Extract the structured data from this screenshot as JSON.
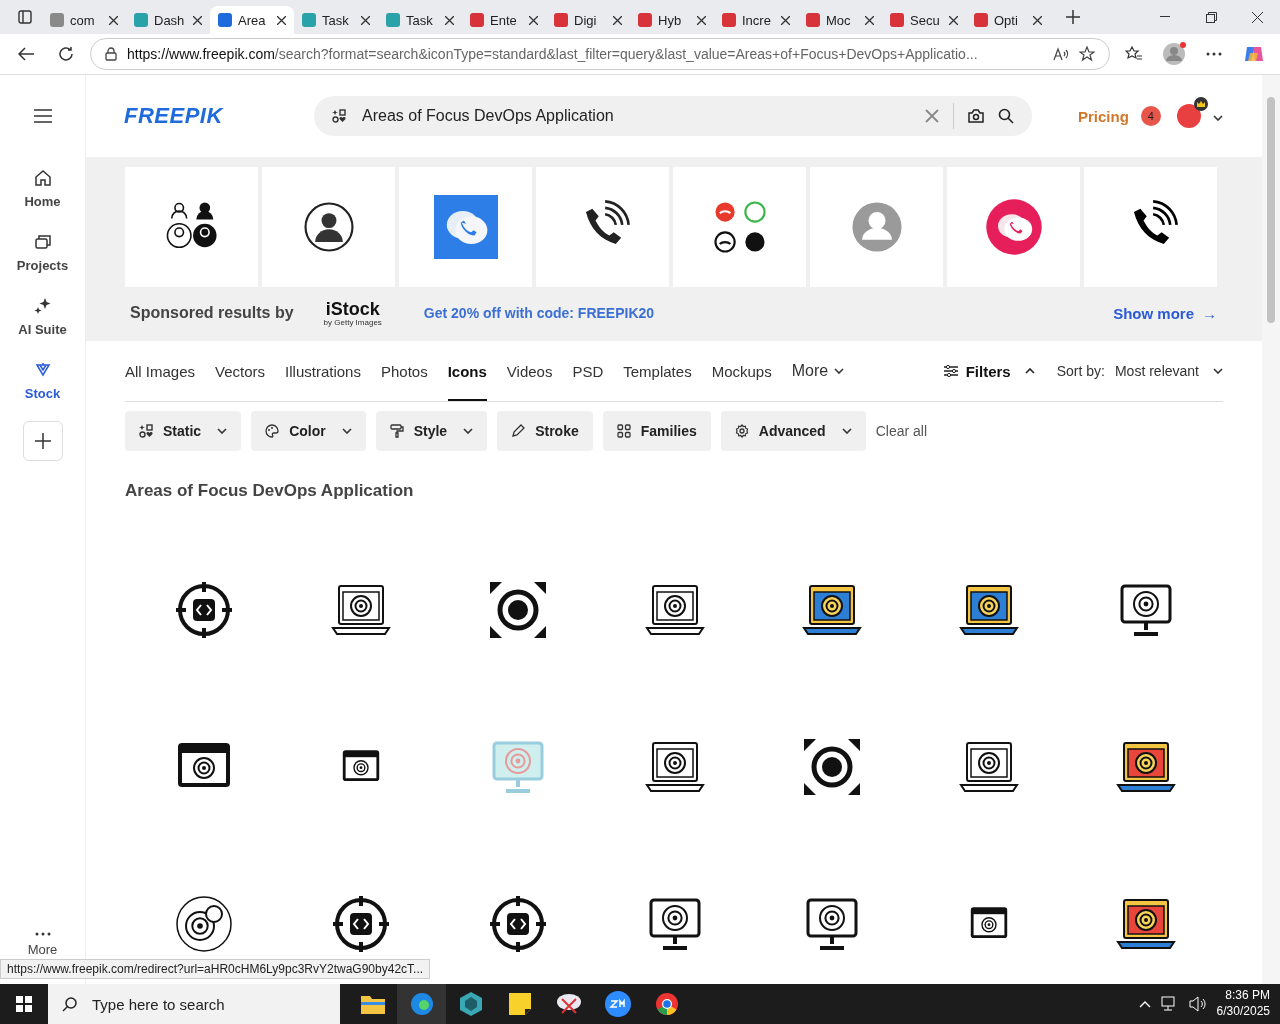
{
  "browser_tabs": [
    {
      "title": "com",
      "selected": false
    },
    {
      "title": "Dash",
      "selected": false
    },
    {
      "title": "Area",
      "selected": true
    },
    {
      "title": "Task",
      "selected": false
    },
    {
      "title": "Task",
      "selected": false
    },
    {
      "title": "Ente",
      "selected": false
    },
    {
      "title": "Digi",
      "selected": false
    },
    {
      "title": "Hyb",
      "selected": false
    },
    {
      "title": "Incre",
      "selected": false
    },
    {
      "title": "Moc",
      "selected": false
    },
    {
      "title": "Secu",
      "selected": false
    },
    {
      "title": "Opti",
      "selected": false
    }
  ],
  "address_bar": {
    "url_host": "https://www.freepik.com",
    "url_rest": "/search?format=search&iconType=standard&last_filter=query&last_value=Areas+of+Focus+DevOps+Applicatio..."
  },
  "sidebar": {
    "items": [
      {
        "label": "Home",
        "selected": false
      },
      {
        "label": "Projects",
        "selected": false
      },
      {
        "label": "AI Suite",
        "selected": false
      },
      {
        "label": "Stock",
        "selected": true
      }
    ],
    "more": "More"
  },
  "header": {
    "logo": "FREEPIK",
    "search_value": "Areas of Focus DevOps Application",
    "pricing": "Pricing",
    "notification_count": "4"
  },
  "sponsored": {
    "label": "Sponsored results by",
    "brand": "iStock",
    "brand_sub": "by Getty Images",
    "promo": "Get 20% off with code: FREEPIK20",
    "show_more": "Show more",
    "arrow": "→"
  },
  "categories": [
    {
      "label": "All Images",
      "selected": false,
      "dropdown": false
    },
    {
      "label": "Vectors",
      "selected": false,
      "dropdown": false
    },
    {
      "label": "Illustrations",
      "selected": false,
      "dropdown": false
    },
    {
      "label": "Photos",
      "selected": false,
      "dropdown": false
    },
    {
      "label": "Icons",
      "selected": true,
      "dropdown": false
    },
    {
      "label": "Videos",
      "selected": false,
      "dropdown": false
    },
    {
      "label": "PSD",
      "selected": false,
      "dropdown": false
    },
    {
      "label": "Templates",
      "selected": false,
      "dropdown": false
    },
    {
      "label": "Mockups",
      "selected": false,
      "dropdown": false
    },
    {
      "label": "More",
      "selected": false,
      "dropdown": true
    }
  ],
  "filters_button": {
    "label": "Filters",
    "expanded": true
  },
  "sort": {
    "label": "Sort by:",
    "value": "Most relevant"
  },
  "filter_chips": [
    {
      "label": "Static",
      "dropdown": true
    },
    {
      "label": "Color",
      "dropdown": true
    },
    {
      "label": "Style",
      "dropdown": true
    },
    {
      "label": "Stroke",
      "dropdown": false
    },
    {
      "label": "Families",
      "dropdown": false
    },
    {
      "label": "Advanced",
      "dropdown": true
    }
  ],
  "clear_all": "Clear all",
  "results_title": "Areas of Focus DevOps Application",
  "status_url": "https://www.freepik.com/redirect?url=aHR0cHM6Ly9pc3RvY2twaG90by42cT...",
  "taskbar": {
    "search_placeholder": "Type here to search",
    "time": "8:36 PM",
    "date": "6/30/2025"
  }
}
